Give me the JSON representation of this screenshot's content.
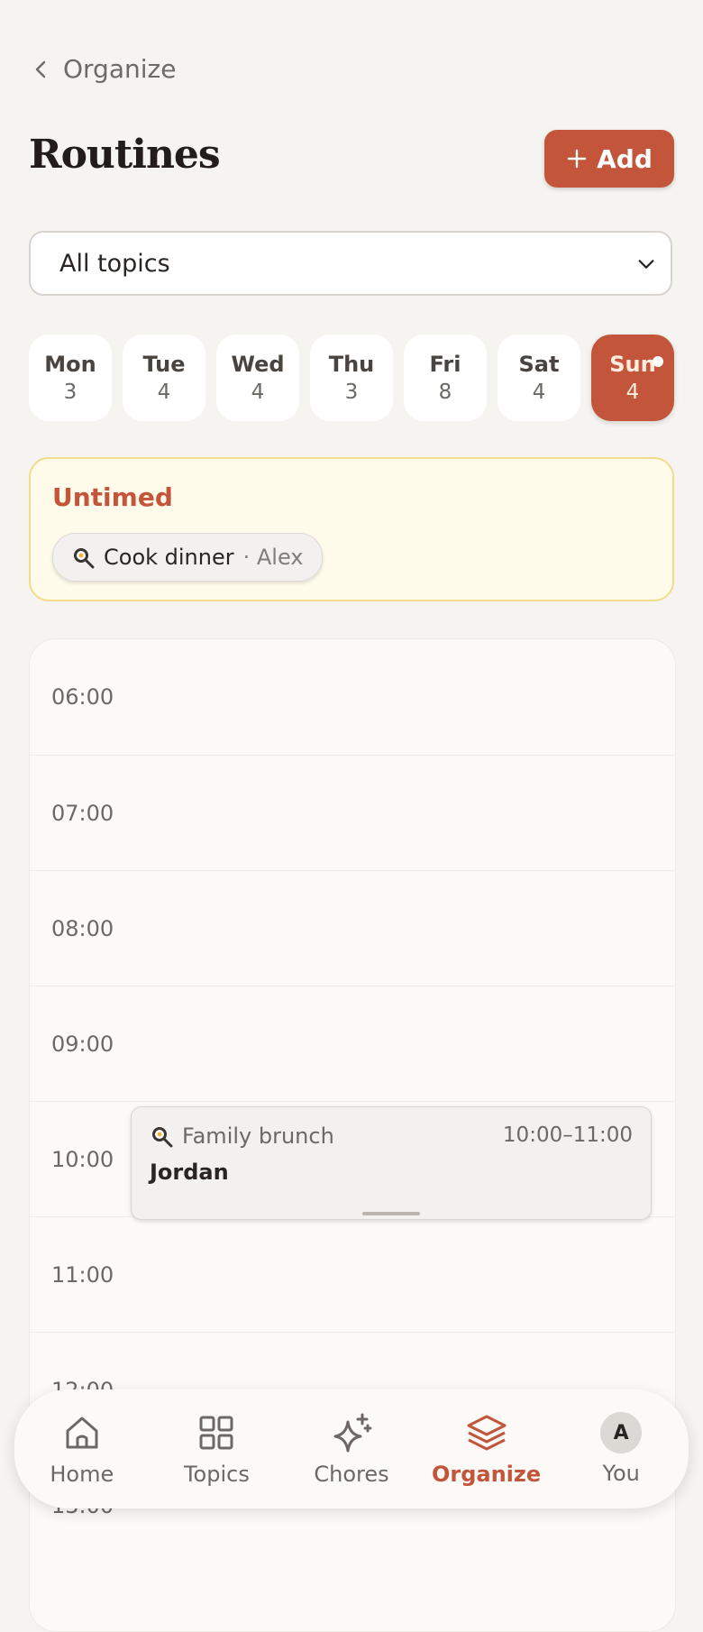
{
  "header": {
    "back_label": "Organize",
    "title": "Routines",
    "add_label": "Add"
  },
  "filter": {
    "value": "All topics"
  },
  "days": [
    {
      "name": "Mon",
      "count": "3"
    },
    {
      "name": "Tue",
      "count": "4"
    },
    {
      "name": "Wed",
      "count": "4"
    },
    {
      "name": "Thu",
      "count": "3"
    },
    {
      "name": "Fri",
      "count": "8"
    },
    {
      "name": "Sat",
      "count": "4"
    },
    {
      "name": "Sun",
      "count": "4",
      "active": true
    }
  ],
  "untimed": {
    "title": "Untimed",
    "items": [
      {
        "icon": "cooking-pan-icon",
        "name": "Cook dinner",
        "who": "· Alex"
      }
    ]
  },
  "timeline": {
    "hours": [
      "06:00",
      "07:00",
      "08:00",
      "09:00",
      "10:00",
      "11:00",
      "12:00",
      "13:00"
    ],
    "events": [
      {
        "icon": "cooking-pan-icon",
        "title": "Family brunch",
        "time": "10:00–11:00",
        "person": "Jordan"
      }
    ]
  },
  "nav": {
    "items": [
      {
        "label": "Home",
        "icon": "home-icon"
      },
      {
        "label": "Topics",
        "icon": "grid-icon"
      },
      {
        "label": "Chores",
        "icon": "sparkle-icon"
      },
      {
        "label": "Organize",
        "icon": "layers-icon",
        "active": true
      },
      {
        "label": "You",
        "icon": "avatar",
        "avatar_letter": "A"
      }
    ]
  },
  "colors": {
    "accent": "#c2553a",
    "background": "#f6f4f0",
    "untimed_bg": "#fffbea",
    "untimed_border": "#f1dc8c"
  }
}
